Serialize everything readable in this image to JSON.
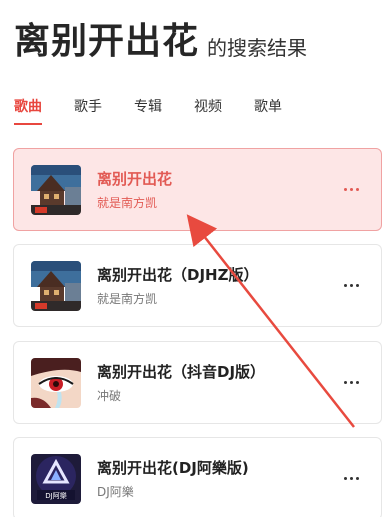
{
  "search": {
    "query": "离别开出花",
    "suffix": "的搜索结果"
  },
  "tabs": [
    {
      "label": "歌曲",
      "active": true
    },
    {
      "label": "歌手",
      "active": false
    },
    {
      "label": "专辑",
      "active": false
    },
    {
      "label": "视频",
      "active": false
    },
    {
      "label": "歌单",
      "active": false
    }
  ],
  "songs": [
    {
      "title": "离别开出花",
      "artist": "就是南方凯",
      "cover": "house-landscape-cover",
      "active": true
    },
    {
      "title": "离别开出花（DJHZ版）",
      "artist": "就是南方凯",
      "cover": "house-landscape-cover",
      "active": false
    },
    {
      "title": "离别开出花（抖音DJ版）",
      "artist": "冲破",
      "cover": "anime-crying-eye-cover",
      "active": false
    },
    {
      "title": "离别开出花(DJ阿樂版)",
      "artist": "DJ阿樂",
      "cover": "dj-logo-cover",
      "active": false,
      "cover_text": "DJ阿樂"
    }
  ],
  "colors": {
    "accent": "#e8473f",
    "active_card_bg": "#fde6e6",
    "arrow": "#e84a3f"
  }
}
